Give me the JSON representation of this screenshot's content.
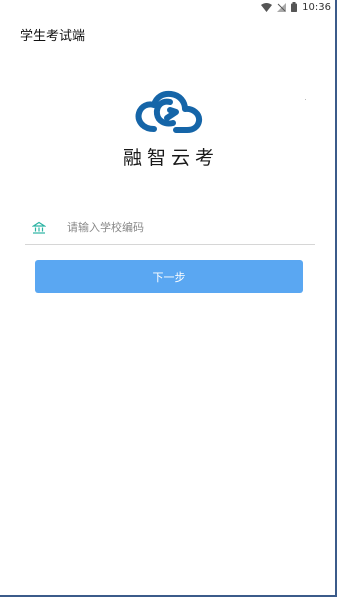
{
  "status_bar": {
    "time": "10:36",
    "icons": [
      "wifi-icon",
      "signal-off-icon",
      "battery-icon"
    ]
  },
  "app_bar": {
    "title": "学生考试端"
  },
  "brand": {
    "name": "融智云考",
    "logo_icon": "cloud-sync-logo",
    "logo_color": "#1565a8"
  },
  "form": {
    "school_code": {
      "icon": "bank-icon",
      "icon_color": "#2bb3a3",
      "value": "",
      "placeholder": "请输入学校编码"
    },
    "next_label": "下一步",
    "next_color": "#5aa7f2"
  }
}
